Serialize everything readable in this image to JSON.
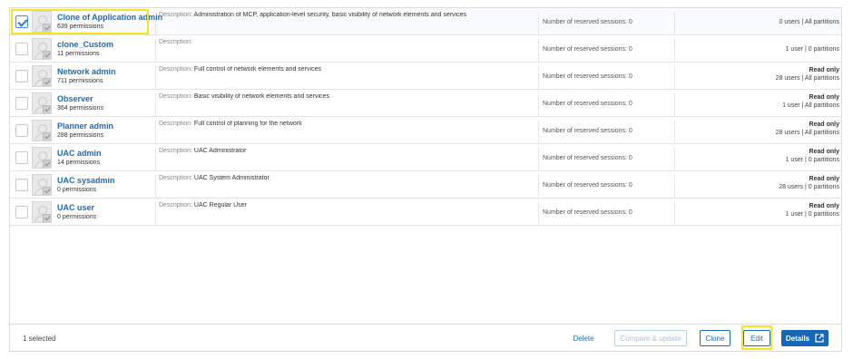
{
  "rows": [
    {
      "name": "Clone of Application admin",
      "permissions": "639 permissions",
      "desc_label": "Description:",
      "desc": "Administration of MCP, application-level security, basic visibility of network elements and services",
      "sessions": "Number of reserved sessions: 0",
      "read_only": "",
      "users": "0 users | All partitions",
      "checked": true
    },
    {
      "name": "clone_Custom",
      "permissions": "11 permissions",
      "desc_label": "Description:",
      "desc": "",
      "sessions": "Number of reserved sessions: 0",
      "read_only": "",
      "users": "1 user | 0 partitions",
      "checked": false
    },
    {
      "name": "Network admin",
      "permissions": "711 permissions",
      "desc_label": "Description:",
      "desc": "Full control of network elements and services",
      "sessions": "Number of reserved sessions: 0",
      "read_only": "Read only",
      "users": "28 users | All partitions",
      "checked": false
    },
    {
      "name": "Observer",
      "permissions": "364 permissions",
      "desc_label": "Description:",
      "desc": "Basic visibility of network elements and services",
      "sessions": "Number of reserved sessions: 0",
      "read_only": "Read only",
      "users": "1 user | All partitions",
      "checked": false
    },
    {
      "name": "Planner admin",
      "permissions": "288 permissions",
      "desc_label": "Description:",
      "desc": "Full control of planning for the network",
      "sessions": "Number of reserved sessions: 0",
      "read_only": "Read only",
      "users": "28 users | All partitions",
      "checked": false
    },
    {
      "name": "UAC admin",
      "permissions": "14 permissions",
      "desc_label": "Description:",
      "desc": "UAC Administrator",
      "sessions": "Number of reserved sessions: 0",
      "read_only": "Read only",
      "users": "1 user | 0 partitions",
      "checked": false
    },
    {
      "name": "UAC sysadmin",
      "permissions": "0 permissions",
      "desc_label": "Description:",
      "desc": "UAC System Administrator",
      "sessions": "Number of reserved sessions: 0",
      "read_only": "Read only",
      "users": "28 users | 0 partitions",
      "checked": false
    },
    {
      "name": "UAC user",
      "permissions": "0 permissions",
      "desc_label": "Description:",
      "desc": "UAC Regular User",
      "sessions": "Number of reserved sessions: 0",
      "read_only": "Read only",
      "users": "1 user | 0 partitions",
      "checked": false
    }
  ],
  "footer": {
    "selected": "1 selected",
    "delete": "Delete",
    "compare": "Compare & update",
    "clone": "Clone",
    "edit": "Edit",
    "details": "Details"
  },
  "colors": {
    "accent": "#1667b5",
    "highlight": "#f6e51c",
    "link": "#1f6bb8"
  },
  "icons": {
    "avatar": "user-avatar-icon",
    "badge": "check-badge-icon",
    "details": "external-link-icon"
  }
}
